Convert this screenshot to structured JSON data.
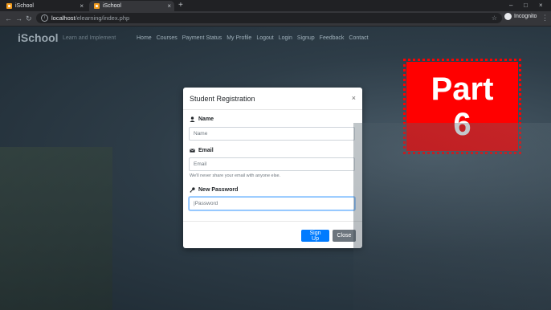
{
  "browser": {
    "tabs": [
      {
        "title": "iSchool",
        "close": "×"
      },
      {
        "title": "iSchool",
        "close": "×"
      }
    ],
    "new_tab": "+",
    "window_controls": {
      "minimize": "–",
      "maximize": "□",
      "close": "×"
    },
    "nav": {
      "back": "←",
      "forward": "→",
      "reload": "↻"
    },
    "url_host": "localhost",
    "url_path": "/elearning/index.php",
    "mode_label": "Incognito"
  },
  "site": {
    "brand": "iSchool",
    "tagline": "Learn and Implement",
    "nav": [
      "Home",
      "Courses",
      "Payment Status",
      "My Profile",
      "Logout",
      "Login",
      "Signup",
      "Feedback",
      "Contact"
    ]
  },
  "stamp": {
    "line1": "Part",
    "line2": "6",
    "color": "#ff0000"
  },
  "modal": {
    "title": "Student Registration",
    "name_label": "Name",
    "name_placeholder": "Name",
    "email_label": "Email",
    "email_placeholder": "Email",
    "email_help": "We'll never share your email with anyone else.",
    "password_label": "New Password",
    "password_placeholder": "Password",
    "signup_label": "Sign Up",
    "close_label": "Close",
    "primary_color": "#007bff",
    "secondary_color": "#6c757d"
  }
}
